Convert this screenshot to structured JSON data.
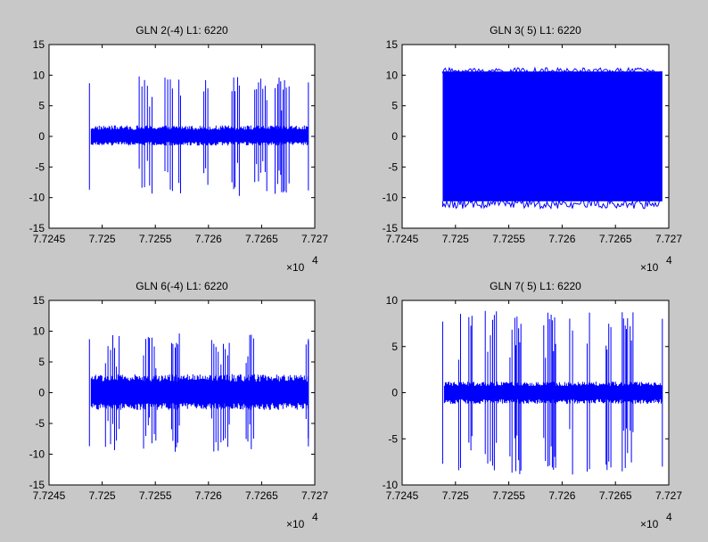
{
  "figure": {
    "background": "#c8c8c8",
    "axes_background": "#ffffff",
    "line_color": "#0000ff"
  },
  "chart_data": [
    {
      "type": "line",
      "title": "GLN  2(-4) L1: 6220",
      "xlim": [
        7.7245,
        7.727
      ],
      "ylim": [
        -15,
        15
      ],
      "xticks": [
        "7.7245",
        "7.725",
        "7.7255",
        "7.726",
        "7.7265",
        "7.727"
      ],
      "yticks": [
        "15",
        "10",
        "5",
        "0",
        "-5",
        "-10",
        "-15"
      ],
      "x_multiplier": "×10",
      "x_exponent": "4",
      "series": [
        {
          "x_range": [
            7.72488,
            7.72694
          ],
          "baseline": [
            -1.5,
            1.8
          ],
          "spike_high": 9.8,
          "spike_low": -9.8,
          "onset_spike": [
            8.7,
            -8.7
          ]
        }
      ]
    },
    {
      "type": "line",
      "title": "GLN  3( 5) L1: 6220",
      "xlim": [
        7.7245,
        7.727
      ],
      "ylim": [
        -15,
        15
      ],
      "xticks": [
        "7.7245",
        "7.725",
        "7.7255",
        "7.726",
        "7.7265",
        "7.727"
      ],
      "yticks": [
        "15",
        "10",
        "5",
        "0",
        "-5",
        "-10",
        "-15"
      ],
      "x_multiplier": "×10",
      "x_exponent": "4",
      "series": [
        {
          "x_range": [
            7.72488,
            7.72694
          ],
          "fill_high": 10.6,
          "fill_low": -10.6,
          "peak_high": 11.2,
          "peak_low": -11.8
        }
      ]
    },
    {
      "type": "line",
      "title": "GLN  6(-4) L1: 6220",
      "xlim": [
        7.7245,
        7.727
      ],
      "ylim": [
        -15,
        15
      ],
      "xticks": [
        "7.7245",
        "7.725",
        "7.7255",
        "7.726",
        "7.7265",
        "7.727"
      ],
      "yticks": [
        "15",
        "10",
        "5",
        "0",
        "-5",
        "-10",
        "-15"
      ],
      "x_multiplier": "×10",
      "x_exponent": "4",
      "series": [
        {
          "x_range": [
            7.72488,
            7.72694
          ],
          "baseline": [
            -2.8,
            3.0
          ],
          "spike_high": 9.7,
          "spike_low": -9.7,
          "onset_spike": [
            8.7,
            -8.7
          ]
        }
      ]
    },
    {
      "type": "line",
      "title": "GLN  7( 5) L1: 6220",
      "xlim": [
        7.7245,
        7.727
      ],
      "ylim": [
        -10,
        10
      ],
      "xticks": [
        "7.7245",
        "7.725",
        "7.7255",
        "7.726",
        "7.7265",
        "7.727"
      ],
      "yticks": [
        "10",
        "5",
        "0",
        "-5",
        "-10"
      ],
      "x_multiplier": "×10",
      "x_exponent": "4",
      "series": [
        {
          "x_range": [
            7.72488,
            7.72694
          ],
          "baseline": [
            -1.2,
            1.2
          ],
          "spike_high": 8.9,
          "spike_low": -8.9,
          "onset_spike": [
            7.7,
            -7.7
          ]
        }
      ]
    }
  ]
}
